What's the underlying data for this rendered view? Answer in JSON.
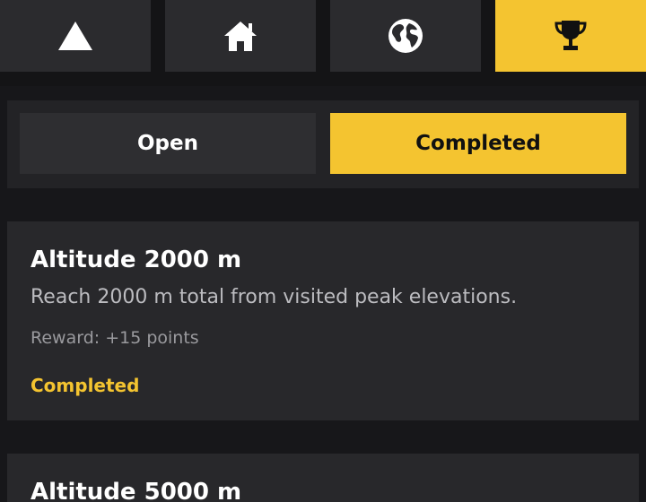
{
  "nav": {
    "tabs": [
      {
        "icon": "triangle-peak-icon",
        "active": false
      },
      {
        "icon": "home-icon",
        "active": false
      },
      {
        "icon": "globe-icon",
        "active": false
      },
      {
        "icon": "trophy-icon",
        "active": true
      }
    ]
  },
  "filter": {
    "open_label": "Open",
    "completed_label": "Completed",
    "selected": "Completed"
  },
  "achievements": [
    {
      "title": "Altitude 2000 m",
      "description": "Reach 2000 m total from visited peak elevations.",
      "reward": "Reward: +15 points",
      "status": "Completed"
    },
    {
      "title": "Altitude 5000 m"
    }
  ],
  "colors": {
    "accent": "#f4c430",
    "background": "#17171a",
    "card": "#28282b",
    "tab": "#2b2b2e"
  }
}
